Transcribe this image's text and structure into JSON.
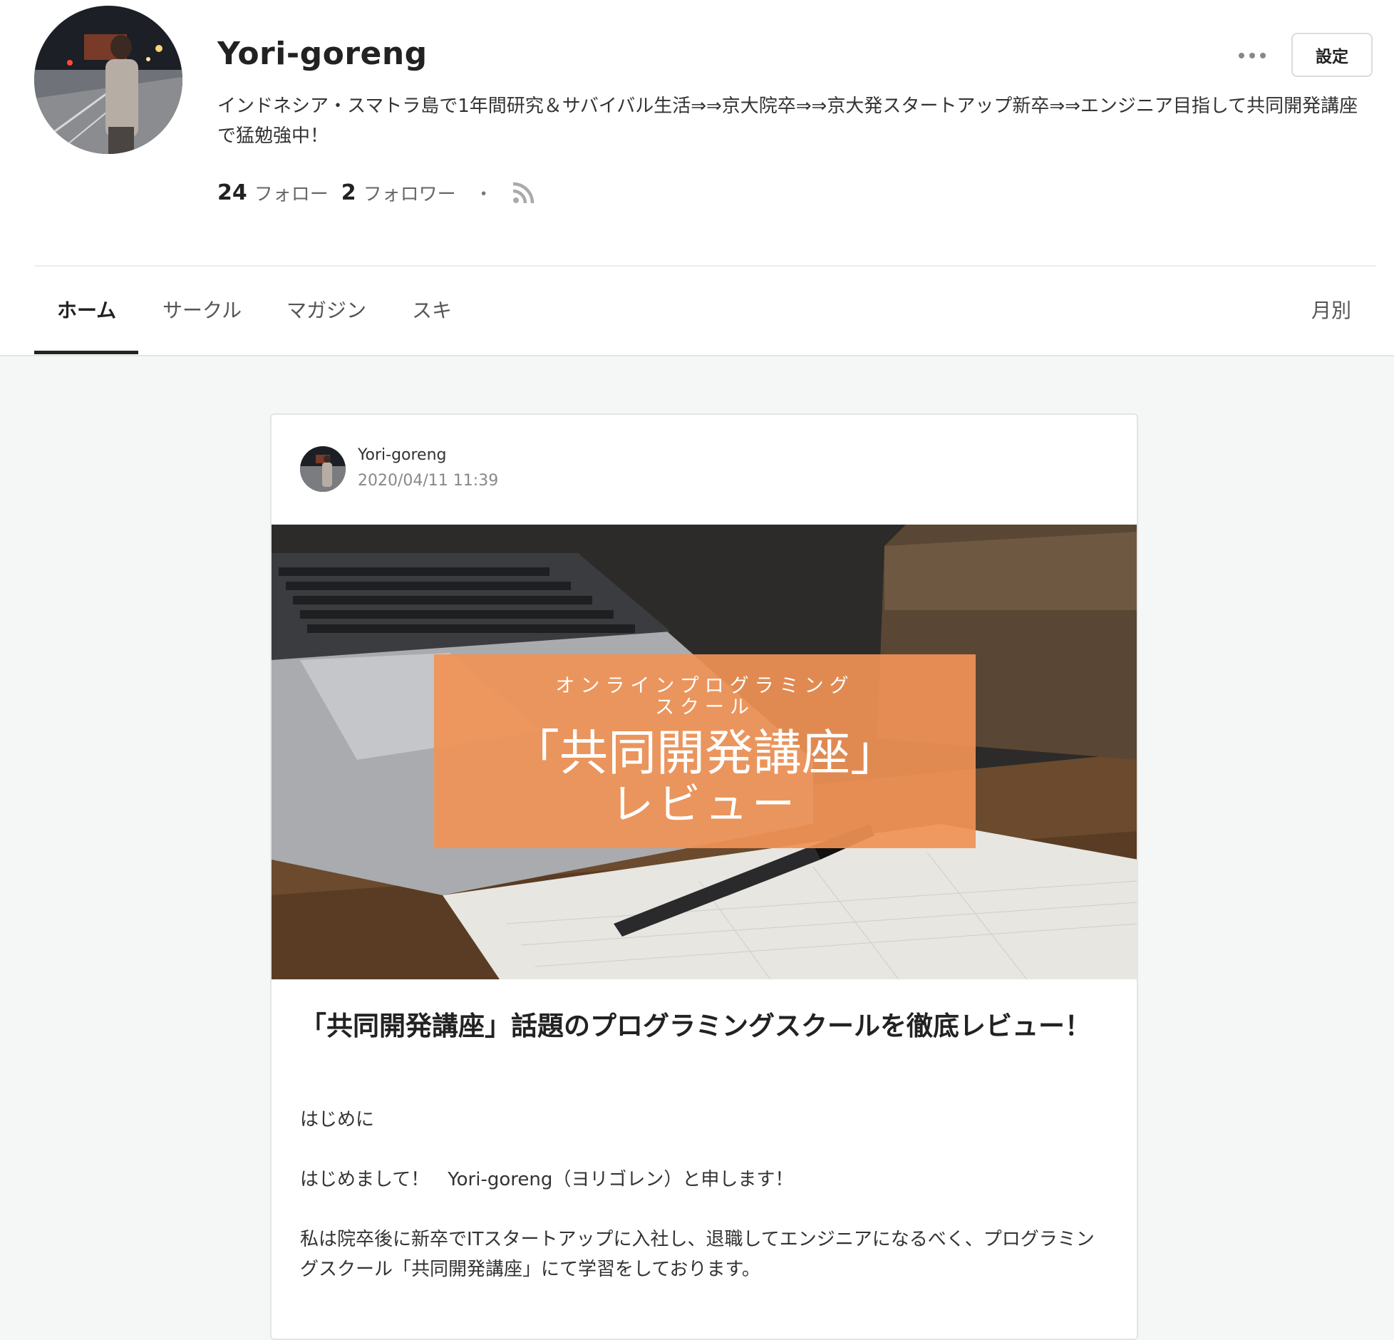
{
  "profile": {
    "name": "Yori-goreng",
    "bio": "インドネシア・スマトラ島で1年間研究＆サバイバル生活⇒⇒京大院卒⇒⇒京大発スタートアップ新卒⇒⇒エンジニア目指して共同開発講座で猛勉強中！",
    "following_count": "24",
    "following_label": "フォロー",
    "followers_count": "2",
    "followers_label": "フォロワー",
    "separator": "・",
    "settings_label": "設定",
    "more_icon": "more-dots-icon",
    "rss_icon": "rss-icon"
  },
  "tabs": [
    {
      "label": "ホーム",
      "active": true
    },
    {
      "label": "サークル"
    },
    {
      "label": "マガジン"
    },
    {
      "label": "スキ"
    }
  ],
  "monthly_label": "月別",
  "post": {
    "author": "Yori-goreng",
    "date": "2020/04/11 11:39",
    "hero": {
      "subtitle": "オンラインプログラミングスクール",
      "title": "「共同開発講座」",
      "title2": "レビュー"
    },
    "title": "「共同開発講座」話題のプログラミングスクールを徹底レビュー！",
    "paragraphs": [
      "はじめに",
      "はじめまして！　Yori-goreng（ヨリゴレン）と申します！",
      "私は院卒後に新卒でITスタートアップに入社し、退職してエンジニアになるべく、プログラミングスクール「共同開発講座」にて学習をしております。"
    ]
  },
  "colors": {
    "accent_overlay": "#f09256",
    "page_bg": "#f5f7f6",
    "active_tab": "#222222"
  }
}
